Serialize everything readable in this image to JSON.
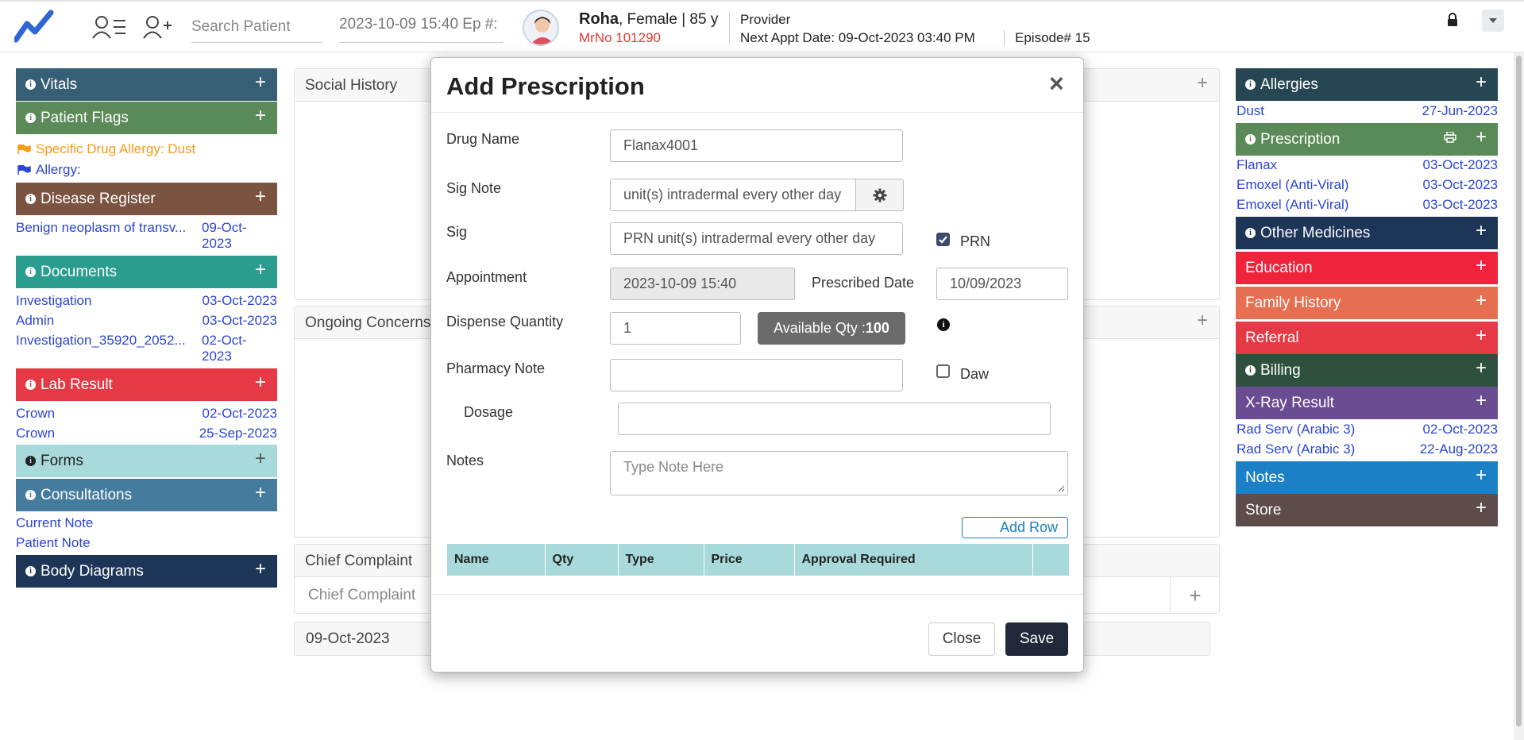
{
  "topbar": {
    "search_placeholder": "Search Patient",
    "episode_field": "2023-10-09 15:40 Ep #:",
    "patient_name": "Roha",
    "patient_meta": ", Female | 85 y",
    "mrno": "MrNo 101290",
    "provider": "Provider",
    "next_appt": "Next Appt Date: 09-Oct-2023 03:40 PM",
    "episode": "Episode# 15"
  },
  "left": {
    "vitals": "Vitals",
    "patient_flags": "Patient Flags",
    "flag1": "Specific Drug Allergy: Dust",
    "flag2": "Allergy:",
    "disease_register": "Disease Register",
    "disease_item": "Benign neoplasm of transv...",
    "disease_date1": "09-Oct-",
    "disease_date2": "2023",
    "documents": "Documents",
    "docs": [
      {
        "name": "Investigation",
        "date": "03-Oct-2023"
      },
      {
        "name": "Admin",
        "date": "03-Oct-2023"
      },
      {
        "name": "Investigation_35920_2052...",
        "date1": "02-Oct-",
        "date2": "2023"
      }
    ],
    "lab_result": "Lab Result",
    "labs": [
      {
        "name": "Crown",
        "date": "02-Oct-2023"
      },
      {
        "name": "Crown",
        "date": "25-Sep-2023"
      }
    ],
    "forms": "Forms",
    "consultations": "Consultations",
    "current_note": "Current Note",
    "patient_note": "Patient Note",
    "body_diagrams": "Body Diagrams"
  },
  "middle": {
    "social_history": "Social History",
    "ongoing_concerns": "Ongoing Concerns",
    "chief_complaint": "Chief Complaint",
    "chief_placeholder": "Chief Complaint",
    "date": "09-Oct-2023"
  },
  "right": {
    "allergies": "Allergies",
    "allergy_item": "Dust",
    "allergy_date": "27-Jun-2023",
    "prescription": "Prescription",
    "presc_items": [
      {
        "name": "Flanax",
        "date": "03-Oct-2023"
      },
      {
        "name": "Emoxel (Anti-Viral)",
        "date": "03-Oct-2023"
      },
      {
        "name": "Emoxel (Anti-Viral)",
        "date": "03-Oct-2023"
      }
    ],
    "other_medicines": "Other Medicines",
    "education": "Education",
    "family_history": "Family History",
    "referral": "Referral",
    "billing": "Billing",
    "xray_result": "X-Ray Result",
    "xray_items": [
      {
        "name": "Rad Serv (Arabic 3)",
        "date": "02-Oct-2023"
      },
      {
        "name": "Rad Serv (Arabic 3)",
        "date": "22-Aug-2023"
      }
    ],
    "notes": "Notes",
    "store": "Store"
  },
  "modal": {
    "title": "Add Prescription",
    "close_x": "×",
    "drug_name_label": "Drug Name",
    "drug_name": "Flanax4001",
    "sig_note_label": "Sig Note",
    "sig_note": "unit(s) intradermal every other day",
    "sig_label": "Sig",
    "sig": "PRN unit(s) intradermal every other day",
    "prn_label": "PRN",
    "prn_checked": true,
    "appointment_label": "Appointment",
    "appointment": "2023-10-09 15:40",
    "prescribed_date_label": "Prescribed Date",
    "prescribed_date": "10/09/2023",
    "dispense_qty_label": "Dispense Quantity",
    "dispense_qty": "1",
    "available_qty_label": "Available Qty : ",
    "available_qty": "100",
    "pharmacy_note_label": "Pharmacy Note",
    "pharmacy_note": "",
    "daw_label": "Daw",
    "daw_checked": false,
    "dosage_label": "Dosage",
    "dosage": "",
    "notes_label": "Notes",
    "notes_placeholder": "Type Note Here",
    "add_row": "Add Row",
    "table_headers": [
      "Name",
      "Qty",
      "Type",
      "Price",
      "Approval Required",
      ""
    ],
    "close_btn": "Close",
    "save_btn": "Save"
  },
  "colors": {
    "vitals": "#365e75",
    "patient_flags": "#5a8a58",
    "disease_register": "#7a5440",
    "documents": "#2a9d8f",
    "lab_result": "#e63946",
    "forms": "#a8dadc",
    "consultations": "#457b9d",
    "body_diagrams": "#1d3557",
    "allergies": "#264653",
    "prescription": "#5a8a58",
    "other_medicines": "#1d3557",
    "education": "#ef233c",
    "family_history": "#e76f51",
    "referral": "#e63946",
    "billing": "#2f4f3f",
    "xray_result": "#6a4c93",
    "notes": "#1b80c6",
    "store": "#5e4b4b"
  }
}
